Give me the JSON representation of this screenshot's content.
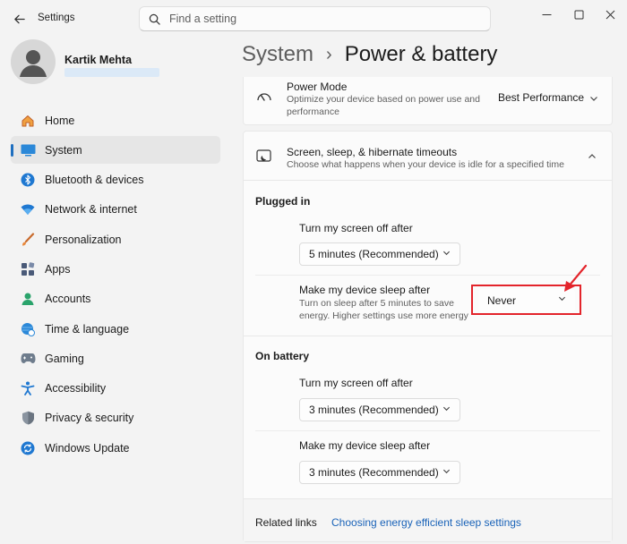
{
  "window": {
    "app_title": "Settings",
    "search_placeholder": "Find a setting"
  },
  "profile": {
    "name": "Kartik Mehta"
  },
  "sidebar": {
    "items": [
      {
        "label": "Home",
        "icon": "home-icon"
      },
      {
        "label": "System",
        "icon": "monitor-icon",
        "selected": true
      },
      {
        "label": "Bluetooth & devices",
        "icon": "bluetooth-icon"
      },
      {
        "label": "Network & internet",
        "icon": "wifi-icon"
      },
      {
        "label": "Personalization",
        "icon": "brush-icon"
      },
      {
        "label": "Apps",
        "icon": "apps-icon"
      },
      {
        "label": "Accounts",
        "icon": "person-icon"
      },
      {
        "label": "Time & language",
        "icon": "globe-clock-icon"
      },
      {
        "label": "Gaming",
        "icon": "gamepad-icon"
      },
      {
        "label": "Accessibility",
        "icon": "accessibility-icon"
      },
      {
        "label": "Privacy & security",
        "icon": "shield-icon"
      },
      {
        "label": "Windows Update",
        "icon": "sync-icon"
      }
    ]
  },
  "breadcrumb": {
    "parent": "System",
    "separator": "›",
    "current": "Power & battery"
  },
  "power_mode": {
    "title": "Power Mode",
    "description": "Optimize your device based on power use and performance",
    "value": "Best Performance"
  },
  "timeouts": {
    "title": "Screen, sleep, & hibernate timeouts",
    "description": "Choose what happens when your device is idle for a specified time",
    "plugged_in": {
      "heading": "Plugged in",
      "screen_off_label": "Turn my screen off after",
      "screen_off_value": "5 minutes (Recommended)",
      "sleep_label": "Make my device sleep after",
      "sleep_desc": "Turn on sleep after 5 minutes to save energy. Higher settings use more energy",
      "sleep_value": "Never"
    },
    "on_battery": {
      "heading": "On battery",
      "screen_off_label": "Turn my screen off after",
      "screen_off_value": "3 minutes (Recommended)",
      "sleep_label": "Make my device sleep after",
      "sleep_value": "3 minutes (Recommended)"
    }
  },
  "related": {
    "label": "Related links",
    "link": "Choosing energy efficient sleep settings"
  },
  "colors": {
    "accent": "#1f6fbf",
    "highlight": "#e3242b",
    "link": "#1a63b8"
  }
}
